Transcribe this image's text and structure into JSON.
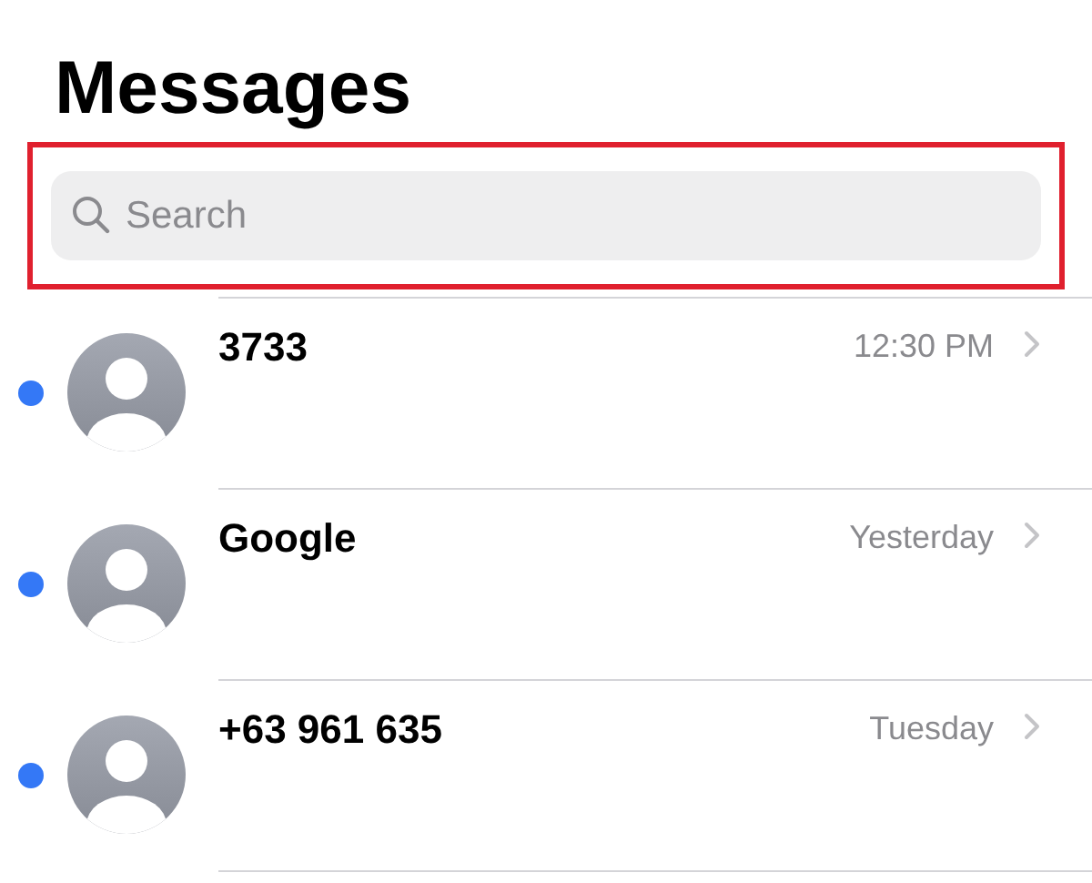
{
  "title": "Messages",
  "search": {
    "placeholder": "Search",
    "highlighted": true
  },
  "conversations": [
    {
      "name": "3733",
      "time": "12:30 PM",
      "unread": true
    },
    {
      "name": "Google",
      "time": "Yesterday",
      "unread": true
    },
    {
      "name": "+63 961 635",
      "time": "Tuesday",
      "unread": true
    }
  ]
}
